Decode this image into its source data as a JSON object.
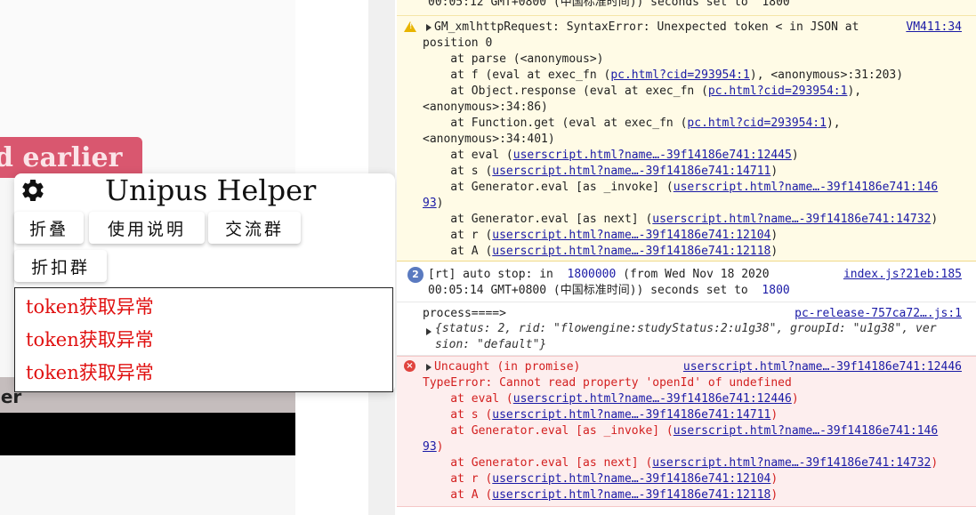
{
  "background_page": {
    "pink_button_text": "d earlier",
    "grey_band_text": "ier"
  },
  "helper": {
    "title": "Unipus Helper",
    "buttons": {
      "fold": "折叠",
      "manual": "使用说明",
      "group": "交流群",
      "discount_group": "折扣群"
    },
    "logs": [
      "token获取异常",
      "token获取异常",
      "token获取异常"
    ]
  },
  "console": {
    "top_partial": "00:05:12 GMT+0800 (中国标准时间)) seconds set to  1800",
    "warning": {
      "icon": "warning-icon",
      "line1": "GM_xmlhttpRequest: SyntaxError: Unexpected token < in JSON at",
      "source": "VM411:34",
      "line2": "position 0",
      "stack": [
        {
          "pre": "    at parse (<anonymous>)",
          "link": "",
          "post": ""
        },
        {
          "pre": "    at f (eval at exec_fn (",
          "link": "pc.html?cid=293954:1",
          "post": "), <anonymous>:31:203)"
        },
        {
          "pre": "    at Object.response (eval at exec_fn (",
          "link": "pc.html?cid=293954:1",
          "post": "),"
        },
        {
          "pre": "<anonymous>:34:86)",
          "link": "",
          "post": ""
        },
        {
          "pre": "    at Function.get (eval at exec_fn (",
          "link": "pc.html?cid=293954:1",
          "post": "),"
        },
        {
          "pre": "<anonymous>:34:401)",
          "link": "",
          "post": ""
        },
        {
          "pre": "    at eval (",
          "link": "userscript.html?name…-39f14186e741:12445",
          "post": ")"
        },
        {
          "pre": "    at s (",
          "link": "userscript.html?name…-39f14186e741:14711",
          "post": ")"
        },
        {
          "pre": "    at Generator.eval [as _invoke] (",
          "link": "userscript.html?name…-39f14186e741:146",
          "post": ""
        },
        {
          "pre": "",
          "link": "93",
          "post": ")"
        },
        {
          "pre": "    at Generator.eval [as next] (",
          "link": "userscript.html?name…-39f14186e741:14732",
          "post": ")"
        },
        {
          "pre": "    at r (",
          "link": "userscript.html?name…-39f14186e741:12104",
          "post": ")"
        },
        {
          "pre": "    at A (",
          "link": "userscript.html?name…-39f14186e741:12118",
          "post": ")"
        }
      ]
    },
    "autostop": {
      "count": "2",
      "pre": "[rt] auto stop: in  ",
      "num": "1800000",
      "post": " (from Wed Nov 18 2020",
      "source": "index.js?21eb:185",
      "line2_pre": "00:05:14 GMT+0800 (中国标准时间)) seconds set to  ",
      "line2_num": "1800"
    },
    "process": {
      "line1": "process====>",
      "source": "pc-release-757ca72….js:1",
      "obj1": "{status: 2, rid: \"flowengine:studyStatus:2:u1g38\", groupId: \"u1g38\", ver",
      "obj2": "sion: \"default\"}"
    },
    "error": {
      "icon": "error-icon",
      "line1": "Uncaught (in promise)",
      "source": "userscript.html?name…-39f14186e741:12446",
      "line2": "TypeError: Cannot read property 'openId' of undefined",
      "stack": [
        {
          "pre": "    at eval (",
          "link": "userscript.html?name…-39f14186e741:12446",
          "post": ")"
        },
        {
          "pre": "    at s (",
          "link": "userscript.html?name…-39f14186e741:14711",
          "post": ")"
        },
        {
          "pre": "    at Generator.eval [as _invoke] (",
          "link": "userscript.html?name…-39f14186e741:146",
          "post": ""
        },
        {
          "pre": "",
          "link": "93",
          "post": ")"
        },
        {
          "pre": "    at Generator.eval [as next] (",
          "link": "userscript.html?name…-39f14186e741:14732",
          "post": ")"
        },
        {
          "pre": "    at r (",
          "link": "userscript.html?name…-39f14186e741:12104",
          "post": ")"
        },
        {
          "pre": "    at A (",
          "link": "userscript.html?name…-39f14186e741:12118",
          "post": ")"
        }
      ]
    }
  }
}
